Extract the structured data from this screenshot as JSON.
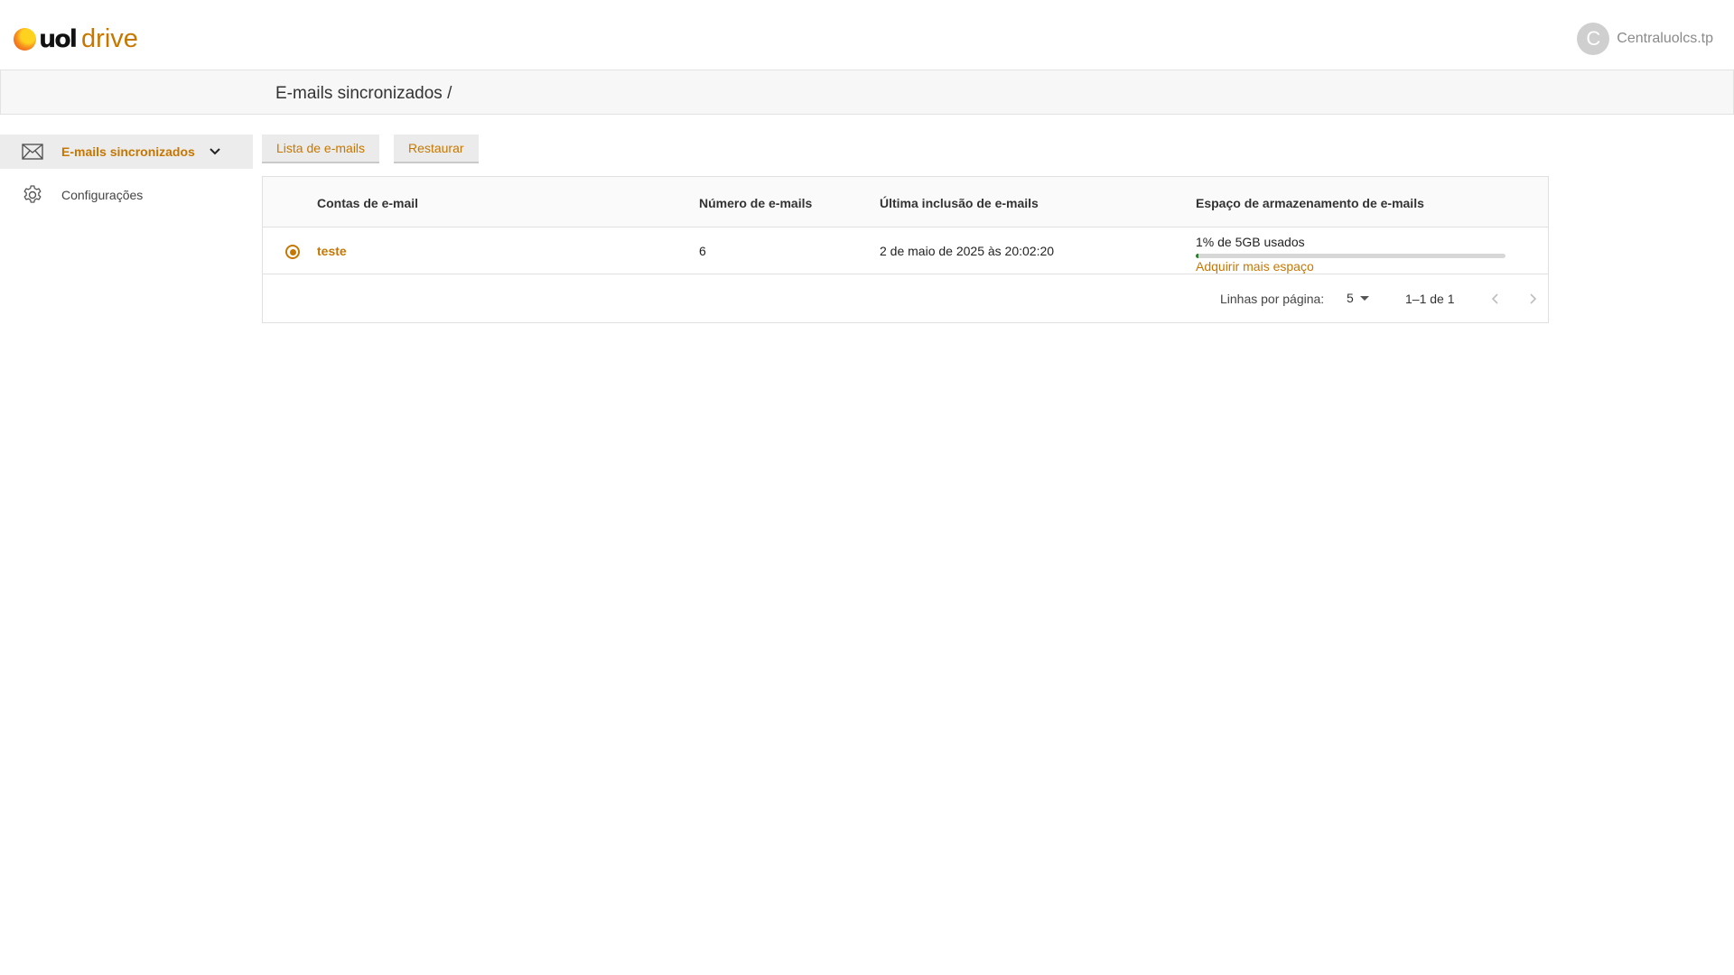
{
  "app": {
    "logo_brand": "uol",
    "logo_product": "drive",
    "user_initial": "C",
    "user_name": "Centraluolcs.tp"
  },
  "breadcrumb": "E-mails sincronizados /",
  "sidebar": {
    "items": [
      {
        "label": "E-mails sincronizados",
        "icon": "mail-icon",
        "active": true
      },
      {
        "label": "Configurações",
        "icon": "gear-icon",
        "active": false
      }
    ]
  },
  "tabs": [
    {
      "label": "Lista de e-mails"
    },
    {
      "label": "Restaurar"
    }
  ],
  "table": {
    "headers": [
      "Contas de e-mail",
      "Número de e-mails",
      "Última inclusão de e-mails",
      "Espaço de armazenamento de e-mails"
    ],
    "rows": [
      {
        "account": "teste",
        "count": "6",
        "last_inclusion": "2 de maio de 2025 às 20:02:20",
        "storage_text": "1% de 5GB usados",
        "storage_fraction": 0.01,
        "buy_link": "Adquirir mais espaço",
        "selected": true
      }
    ]
  },
  "pagination": {
    "rows_label": "Linhas por página:",
    "rows_value": "5",
    "range": "1–1 de 1"
  },
  "colors": {
    "accent": "#c77700",
    "progress": "#2e7d32"
  }
}
